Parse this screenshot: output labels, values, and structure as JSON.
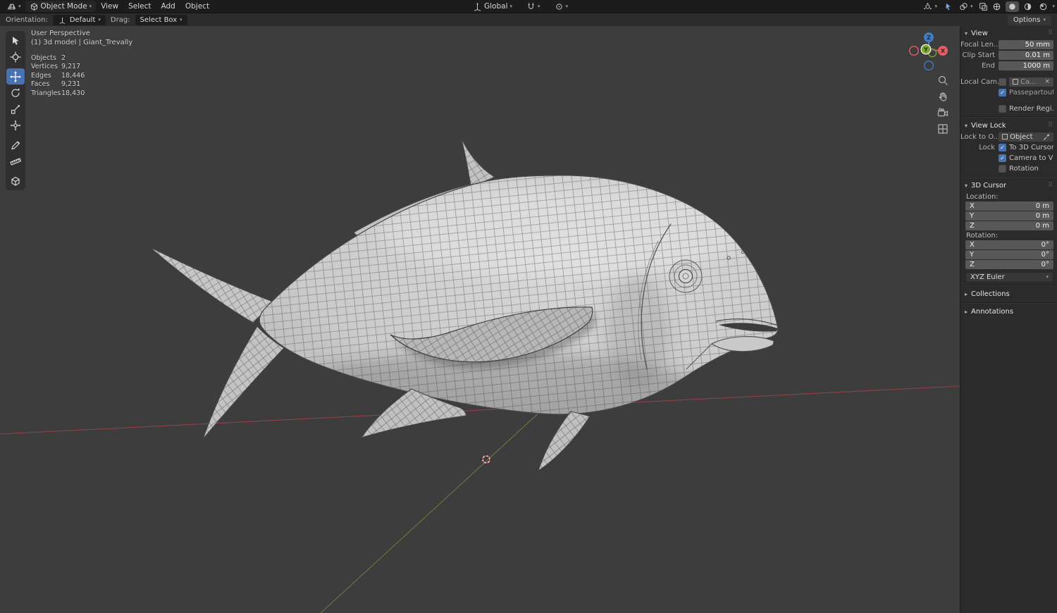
{
  "colors": {
    "accent": "#4772b3",
    "axis_x": "#e25e68",
    "axis_y": "#7aa82e",
    "axis_z": "#3f7cc4",
    "viewport_bg": "#3d3d3d"
  },
  "icons": {
    "chevron_down": "▾",
    "chevron_right": "▸",
    "grip": "⠿",
    "check": "✓",
    "clear": "×"
  },
  "topbar": {
    "mode": "Object Mode",
    "menus": [
      "View",
      "Select",
      "Add",
      "Object"
    ],
    "transform_orientation": "Global",
    "right_icons": [
      "gizmos",
      "show-overlays",
      "toggle-xray",
      "shading-wireframe",
      "shading-solid",
      "shading-material",
      "shading-rendered"
    ]
  },
  "tool_settings": {
    "orientation_label": "Orientation:",
    "orientation_value": "Default",
    "drag_label": "Drag:",
    "drag_value": "Select Box",
    "options_label": "Options"
  },
  "tools": [
    "select-box",
    "cursor",
    "move",
    "rotate",
    "scale",
    "transform",
    "annotate",
    "measure",
    "add-cube"
  ],
  "active_tool": "move",
  "viewport": {
    "view_name": "User Perspective",
    "scene_name": "(1) 3d model | Giant_Trevally",
    "stats": [
      {
        "label": "Objects",
        "value": "2"
      },
      {
        "label": "Vertices",
        "value": "9,217"
      },
      {
        "label": "Edges",
        "value": "18,446"
      },
      {
        "label": "Faces",
        "value": "9,231"
      },
      {
        "label": "Triangles",
        "value": "18,430"
      }
    ]
  },
  "gizmo": {
    "x": "X",
    "y": "Y",
    "z": "Z"
  },
  "sidebar": {
    "view": {
      "title": "View",
      "rows": [
        {
          "label": "Focal Len...",
          "value": "50 mm"
        },
        {
          "label": "Clip Start",
          "value": "0.01 m"
        },
        {
          "label": "End",
          "value": "1000 m"
        }
      ],
      "local_camera": {
        "label": "Local Cam...",
        "value": "Ca...",
        "checked": false
      },
      "passepartout": {
        "label": "Passepartout",
        "checked": true
      },
      "render_region": {
        "label": "Render Regi...",
        "checked": false
      }
    },
    "view_lock": {
      "title": "View Lock",
      "lock_to_label": "Lock to O...",
      "lock_to_value": "Object",
      "lock_label": "Lock",
      "checkboxes": [
        {
          "label": "To 3D Cursor",
          "checked": true
        },
        {
          "label": "Camera to Vi...",
          "checked": true
        },
        {
          "label": "Rotation",
          "checked": false
        }
      ]
    },
    "cursor3d": {
      "title": "3D Cursor",
      "location_label": "Location:",
      "location": [
        {
          "axis": "X",
          "value": "0 m"
        },
        {
          "axis": "Y",
          "value": "0 m"
        },
        {
          "axis": "Z",
          "value": "0 m"
        }
      ],
      "rotation_label": "Rotation:",
      "rotation": [
        {
          "axis": "X",
          "value": "0°"
        },
        {
          "axis": "Y",
          "value": "0°"
        },
        {
          "axis": "Z",
          "value": "0°"
        }
      ],
      "euler_mode": "XYZ Euler"
    },
    "collections_title": "Collections",
    "annotations_title": "Annotations"
  }
}
